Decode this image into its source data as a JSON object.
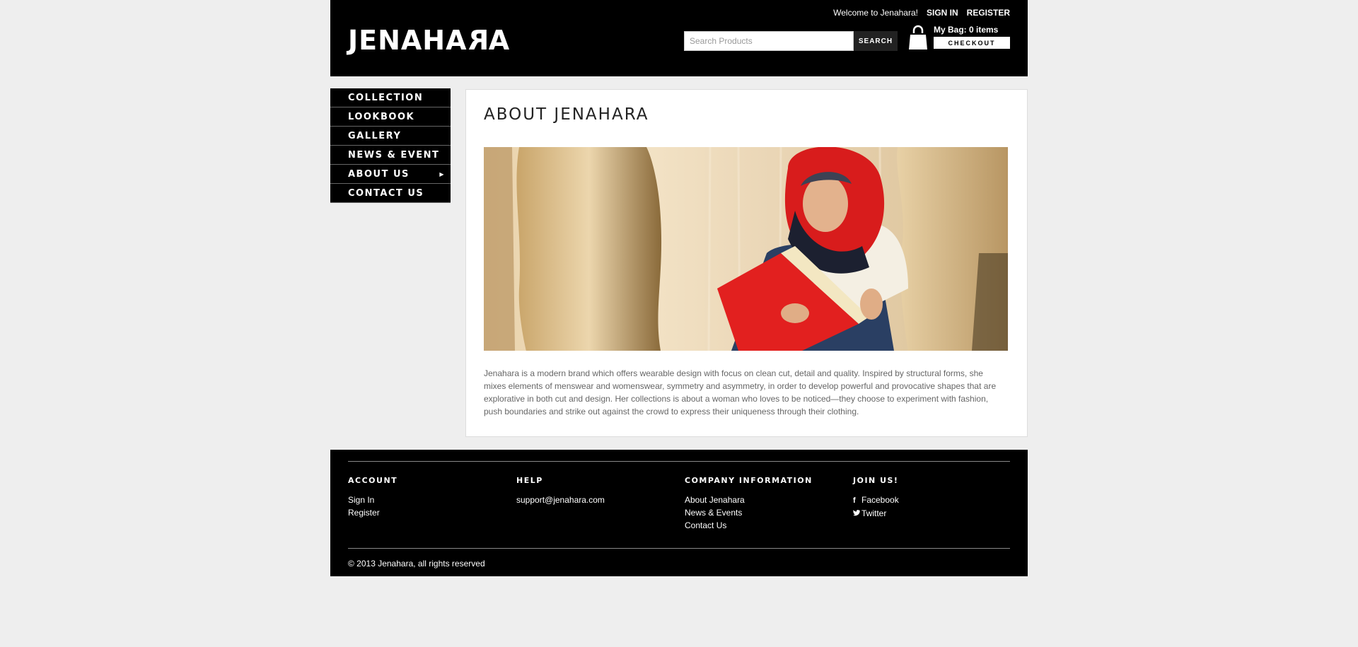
{
  "header": {
    "logo_text_a": "JENAHA",
    "logo_text_rev": "R",
    "logo_text_b": "A",
    "welcome": "Welcome to Jenahara!",
    "sign_in": "SIGN IN",
    "register": "REGISTER",
    "search_placeholder": "Search Products",
    "search_button": "SEARCH",
    "bag_label": "My Bag: 0 items",
    "checkout": "CHECKOUT"
  },
  "nav": {
    "items": [
      "COLLECTION",
      "LOOKBOOK",
      "GALLERY",
      "NEWS & EVENT",
      "ABOUT US",
      "CONTACT US"
    ],
    "about_arrow": "▶"
  },
  "main": {
    "title": "ABOUT JENAHARA",
    "body": "Jenahara is a modern brand which offers wearable design with focus on clean cut, detail and quality. Inspired by structural forms, she mixes elements of menswear and womenswear, symmetry and asymmetry, in order to develop powerful and provocative shapes that are explorative in both cut and design. Her collections is about a woman who loves to be noticed—they choose to experiment with fashion, push boundaries and strike out against the crowd to express their uniqueness through their clothing."
  },
  "footer": {
    "account": {
      "title": "ACCOUNT",
      "links": [
        "Sign In",
        "Register"
      ]
    },
    "help": {
      "title": "HELP",
      "links": [
        "support@jenahara.com"
      ]
    },
    "company": {
      "title": "COMPANY INFORMATION",
      "links": [
        "About Jenahara",
        "News & Events",
        "Contact Us"
      ]
    },
    "join": {
      "title": "JOIN US!",
      "facebook": "Facebook",
      "twitter": "Twitter"
    },
    "copyright": "© 2013 Jenahara, all rights reserved"
  },
  "colors": {
    "header_bg": "#000000",
    "page_bg": "#eeeeee",
    "accent_red": "#d81c1c"
  }
}
